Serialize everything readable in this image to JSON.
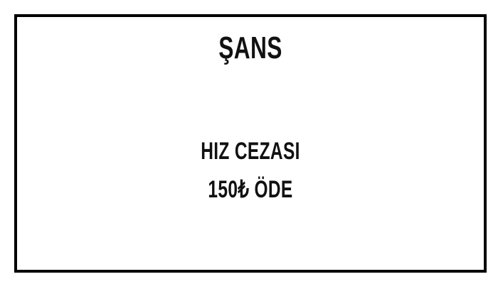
{
  "card": {
    "title": "ŞANS",
    "lines": [
      "HIZ CEZASI",
      "150₺ ÖDE"
    ]
  },
  "colors": {
    "border": "#000000",
    "text": "#111111",
    "background": "#ffffff"
  }
}
